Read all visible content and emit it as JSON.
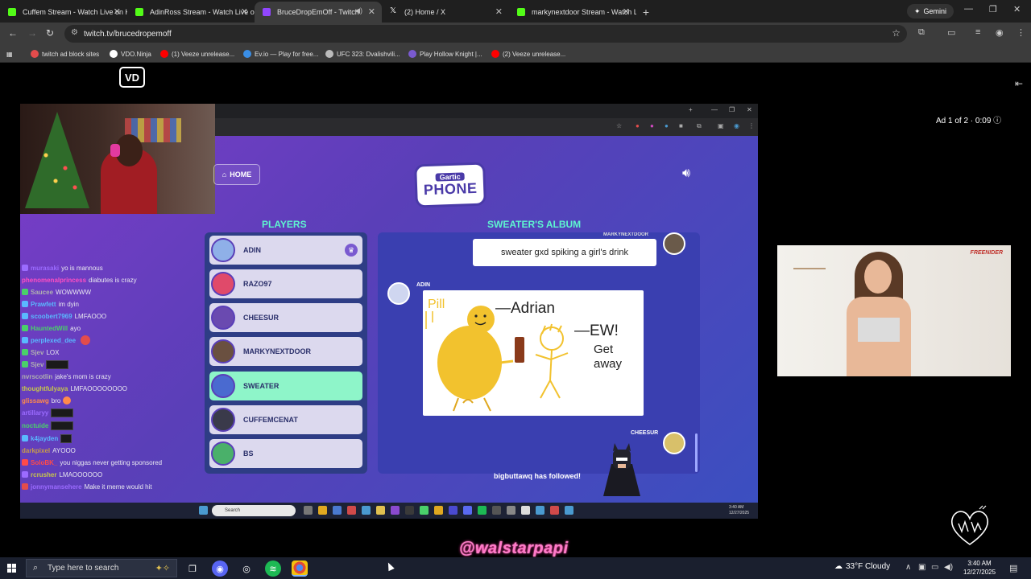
{
  "tabs": [
    {
      "title": "Cuffem Stream - Watch Live on Kick",
      "color": "#53fc18"
    },
    {
      "title": "AdinRoss Stream - Watch Live on Kick",
      "color": "#53fc18"
    },
    {
      "title": "BruceDropEmOff - Twitch",
      "color": "#9146ff",
      "active": true
    },
    {
      "title": "(2) Home / X",
      "color": "#ffffff"
    },
    {
      "title": "markynextdoor Stream - Watch Live on Kick",
      "color": "#53fc18"
    }
  ],
  "gemini_label": "Gemini",
  "address": "twitch.tv/brucedropemoff",
  "bookmarks": [
    {
      "label": "twitch ad block sites",
      "color": "#e34c4c"
    },
    {
      "label": "VDO.Ninja",
      "color": "#ffffff"
    },
    {
      "label": "(1) Veeze unrelease...",
      "color": "#ff0000"
    },
    {
      "label": "Ev.io — Play for free...",
      "color": "#3a8ee6"
    },
    {
      "label": "UFC 323: Dvalishvili...",
      "color": "#bbbbbb"
    },
    {
      "label": "Play Hollow Knight |...",
      "color": "#7a5ad0"
    },
    {
      "label": "(2) Veeze unrelease...",
      "color": "#ff0000"
    }
  ],
  "vdo_badge": "VD",
  "ad_label": "Ad 1 of 2 · 0:09 ⓘ",
  "game": {
    "home_label": "HOME",
    "logo_top": "Gartic",
    "logo_bottom": "PHONE",
    "players_title": "PLAYERS",
    "album_title": "SWEATER'S ALBUM",
    "players": [
      {
        "name": "ADIN",
        "color": "#8fb0e8",
        "crown": true
      },
      {
        "name": "RAZO97",
        "color": "#e04a6a"
      },
      {
        "name": "CHEESUR",
        "color": "#6a4ab0"
      },
      {
        "name": "MARKYNEXTDOOR",
        "color": "#6a5040"
      },
      {
        "name": "SWEATER",
        "color": "#4a6ad0",
        "active": true
      },
      {
        "name": "CUFFEMCENAT",
        "color": "#3a3a4a"
      },
      {
        "name": "BS",
        "color": "#4ab06a"
      }
    ],
    "top_msg_name": "MARKYNEXTDOOR",
    "top_msg": "sweater gxd spiking a girl's drink",
    "adin_label": "ADIN",
    "drawing_texts": [
      "Pill",
      "—Adrian",
      "—EW!",
      "Get",
      "away"
    ],
    "cheesur_label": "CHEESUR",
    "follow_alert": "bigbuttawq has followed!"
  },
  "chat": [
    {
      "user": "murasaki",
      "text": "yo is mannous",
      "color": "#9b6bff"
    },
    {
      "user": "phenomenalprincess",
      "text": "diabutes is crazy",
      "color": "#ff4fc3"
    },
    {
      "user": "Saucee",
      "text": "WOWWWW",
      "color": "#b0b0b0"
    },
    {
      "user": "Prawfett",
      "text": "im dyin",
      "color": "#5ab8ff"
    },
    {
      "user": "scoobert7969",
      "text": "LMFAOOO",
      "color": "#5ab8ff"
    },
    {
      "user": "HauntedWill",
      "text": "ayo",
      "color": "#4ad06a"
    },
    {
      "user": "perplexed_dee",
      "text": "",
      "color": "#5ab8ff"
    },
    {
      "user": "Sjev",
      "text": "LOX",
      "color": "#b0b0b0"
    },
    {
      "user": "Sjev",
      "text": "",
      "color": "#b0b0b0"
    },
    {
      "user": "nvrscotlin",
      "text": "jake's mom is crazy",
      "color": "#b0b0b0"
    },
    {
      "user": "thoughtfulyaya",
      "text": "LMFAOOOOOOOO",
      "color": "#c7c74a"
    },
    {
      "user": "glissawg",
      "text": "bro",
      "color": "#ff8a4a"
    },
    {
      "user": "artillaryy",
      "text": "",
      "color": "#9b6bff"
    },
    {
      "user": "noctuide",
      "text": "",
      "color": "#4ad06a"
    },
    {
      "user": "k4jayden",
      "text": "",
      "color": "#5ab8ff"
    },
    {
      "user": "darkpixel",
      "text": "AYOOO",
      "color": "#c79b4a"
    },
    {
      "user": "SoloBK_",
      "text": "you niggas never getting sponsored",
      "color": "#ff4a4a"
    },
    {
      "user": "rcrusher",
      "text": "LMAOOOOOO",
      "color": "#c7c74a"
    },
    {
      "user": "jonnymansehere",
      "text": "Make it meme would hit",
      "color": "#9b6bff"
    }
  ],
  "ad_brand": "FREENIDER",
  "watermark": "@walstarpapi",
  "taskbar": {
    "search_placeholder": "Type here to search",
    "weather": "33°F  Cloudy",
    "time": "3:40 AM",
    "date": "12/27/2025"
  },
  "stream_taskbar": {
    "search": "Search",
    "time": "3:40 AM",
    "date": "12/27/2025"
  }
}
